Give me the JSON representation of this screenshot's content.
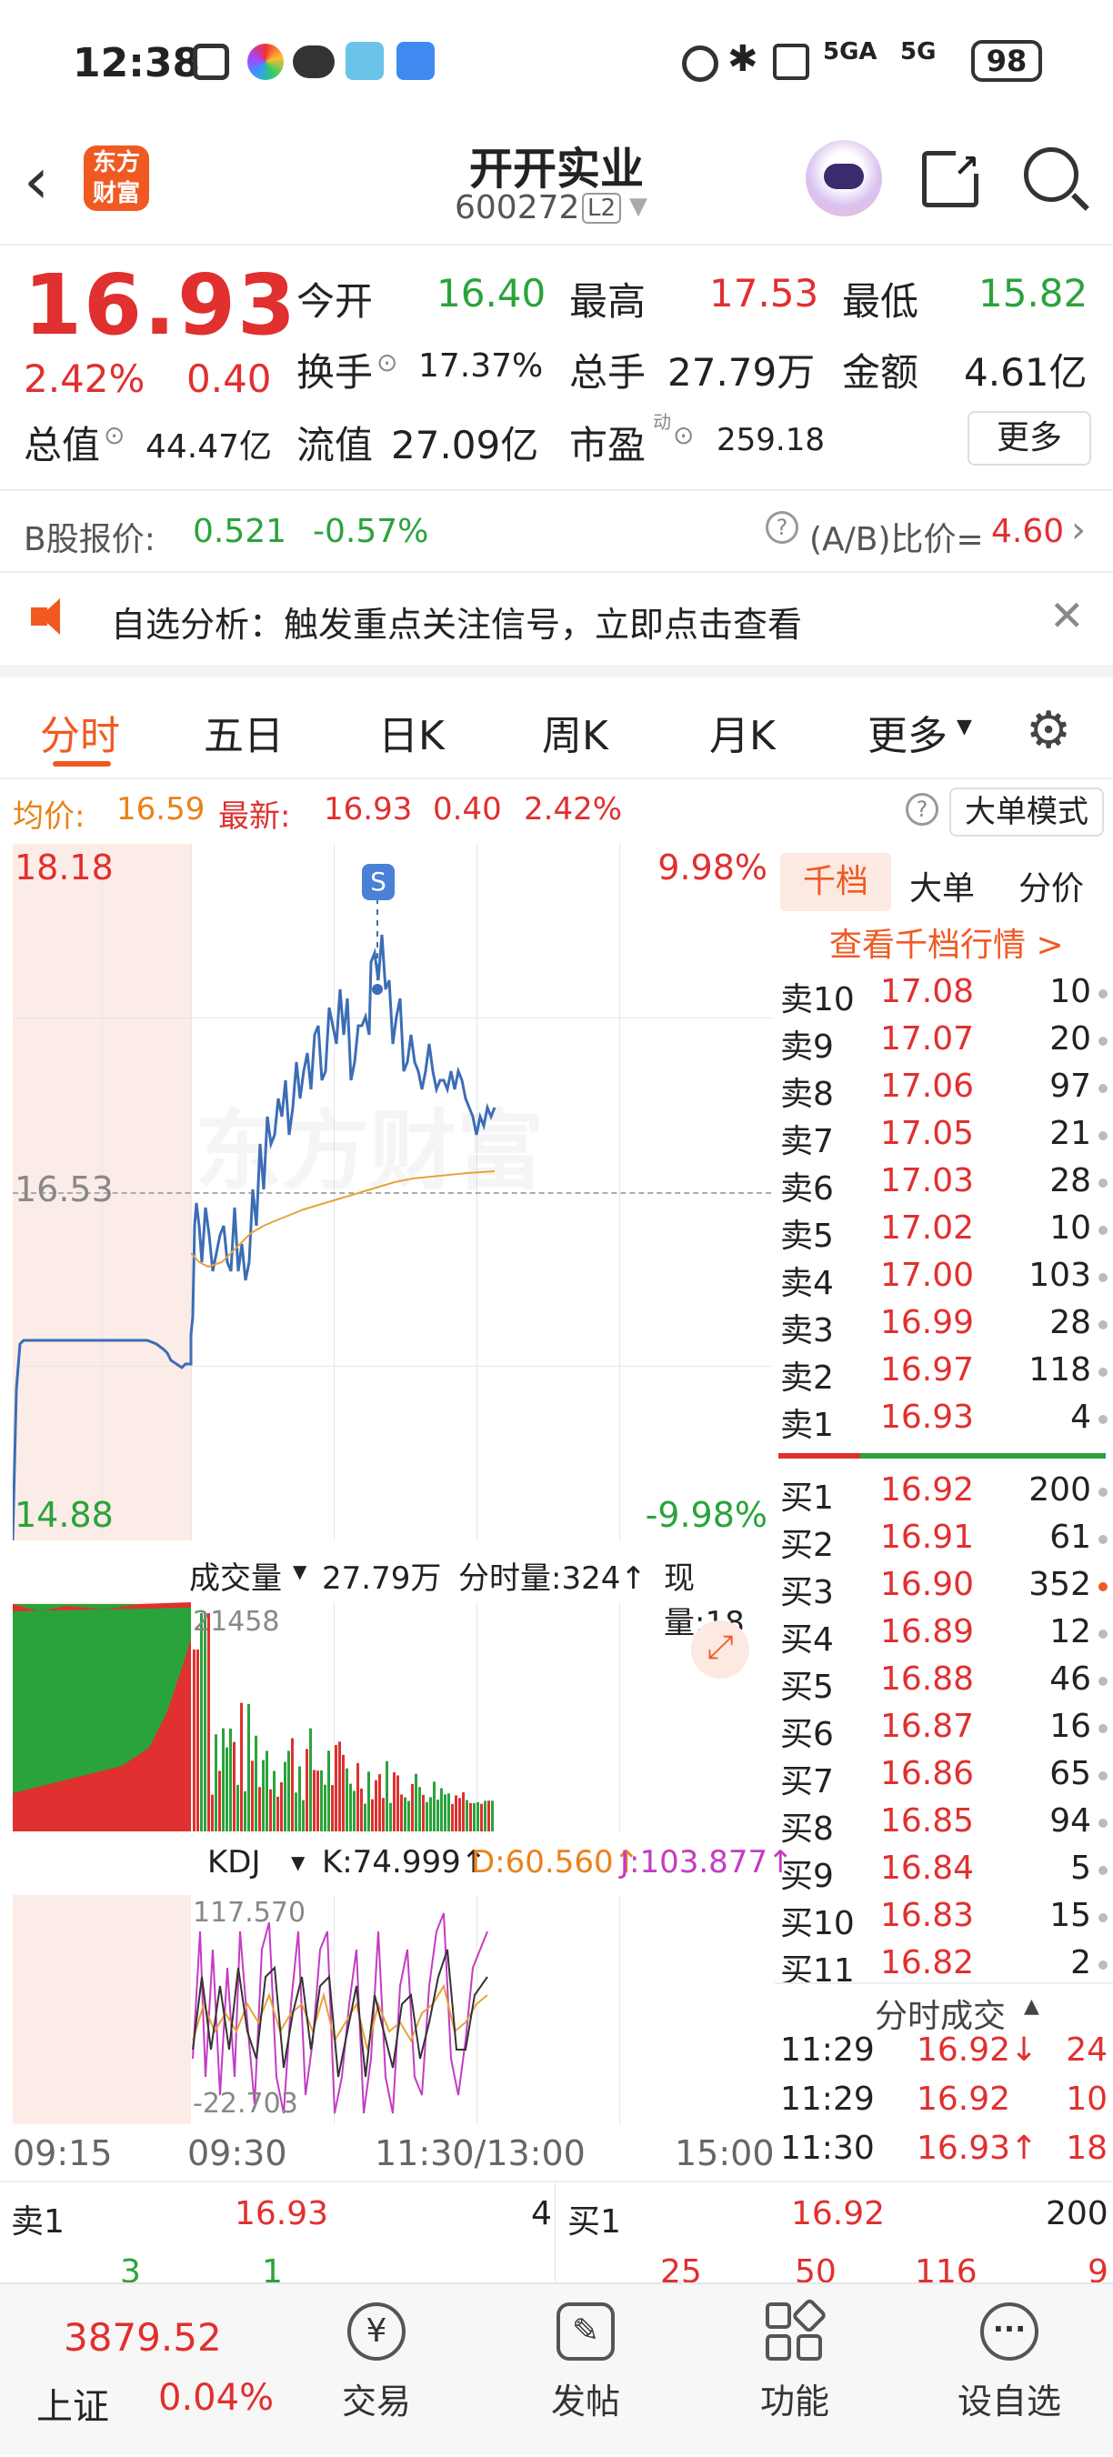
{
  "status": {
    "time": "12:38",
    "battery": "98",
    "signal1": "5GA",
    "signal2": "5G"
  },
  "header": {
    "logo_line1": "东方",
    "logo_line2": "财富",
    "title": "开开实业",
    "code": "600272",
    "level": "L2"
  },
  "quote": {
    "price": "16.93",
    "change_pct": "2.42%",
    "change": "0.40",
    "open_label": "今开",
    "open": "16.40",
    "high_label": "最高",
    "high": "17.53",
    "low_label": "最低",
    "low": "15.82",
    "turnover_label": "换手",
    "turnover": "17.37%",
    "volume_label": "总手",
    "volume": "27.79万",
    "amount_label": "金额",
    "amount": "4.61亿",
    "mktcap_label": "总值",
    "mktcap": "44.47亿",
    "float_label": "流值",
    "float": "27.09亿",
    "pe_label": "市盈",
    "pe_sup": "动",
    "pe": "259.18",
    "more_button": "更多"
  },
  "bshare": {
    "label": "B股报价:",
    "price": "0.521",
    "pct": "-0.57%",
    "ratio_label": "(A/B)比价=",
    "ratio": "4.60"
  },
  "notice": {
    "text": "自选分析：触发重点关注信号，立即点击查看"
  },
  "tabs": [
    "分时",
    "五日",
    "日K",
    "周K",
    "月K",
    "更多"
  ],
  "avgline": {
    "avg_label": "均价:",
    "avg": "16.59",
    "last_label": "最新:",
    "last": "16.93",
    "chg": "0.40",
    "pct": "2.42%",
    "mode_button": "大单模式"
  },
  "chart": {
    "ymax": "18.18",
    "ymid": "16.53",
    "ymin": "14.88",
    "pct_max": "9.98%",
    "pct_min": "-9.98%",
    "marker": "S",
    "watermark": "东方财富",
    "vol_label": "成交量",
    "vol_total": "27.79万",
    "vol_tick_label": "分时量:324↑",
    "vol_now": "现量:18",
    "vol_max": "21458",
    "kdj_label": "KDJ",
    "kdj_k": "K:74.999↑",
    "kdj_d": "D:60.560↑",
    "kdj_j": "J:103.877↑",
    "kdj_max": "117.570",
    "kdj_min": "-22.703",
    "times": [
      "09:15",
      "09:30",
      "11:30/13:00",
      "15:00"
    ]
  },
  "book": {
    "tabs": [
      "千档",
      "大单",
      "分价"
    ],
    "link": "查看千档行情 >",
    "asks": [
      {
        "l": "卖10",
        "p": "17.08",
        "v": "10"
      },
      {
        "l": "卖9",
        "p": "17.07",
        "v": "20"
      },
      {
        "l": "卖8",
        "p": "17.06",
        "v": "97"
      },
      {
        "l": "卖7",
        "p": "17.05",
        "v": "21"
      },
      {
        "l": "卖6",
        "p": "17.03",
        "v": "28"
      },
      {
        "l": "卖5",
        "p": "17.02",
        "v": "10"
      },
      {
        "l": "卖4",
        "p": "17.00",
        "v": "103"
      },
      {
        "l": "卖3",
        "p": "16.99",
        "v": "28"
      },
      {
        "l": "卖2",
        "p": "16.97",
        "v": "118"
      },
      {
        "l": "卖1",
        "p": "16.93",
        "v": "4"
      }
    ],
    "bids": [
      {
        "l": "买1",
        "p": "16.92",
        "v": "200"
      },
      {
        "l": "买2",
        "p": "16.91",
        "v": "61"
      },
      {
        "l": "买3",
        "p": "16.90",
        "v": "352"
      },
      {
        "l": "买4",
        "p": "16.89",
        "v": "12"
      },
      {
        "l": "买5",
        "p": "16.88",
        "v": "46"
      },
      {
        "l": "买6",
        "p": "16.87",
        "v": "16"
      },
      {
        "l": "买7",
        "p": "16.86",
        "v": "65"
      },
      {
        "l": "买8",
        "p": "16.85",
        "v": "94"
      },
      {
        "l": "买9",
        "p": "16.84",
        "v": "5"
      },
      {
        "l": "买10",
        "p": "16.83",
        "v": "15"
      },
      {
        "l": "买11",
        "p": "16.82",
        "v": "2"
      }
    ],
    "trades_title": "分时成交",
    "trades": [
      {
        "t": "11:29",
        "p": "16.92↓",
        "v": "24"
      },
      {
        "t": "11:29",
        "p": "16.92",
        "v": "10"
      },
      {
        "t": "11:30",
        "p": "16.93↑",
        "v": "18"
      }
    ]
  },
  "bottom_quote": {
    "sell_label": "卖1",
    "sell_price": "16.93",
    "sell_vol": "4",
    "buy_label": "买1",
    "buy_price": "16.92",
    "buy_vol": "200",
    "n1": "3",
    "n2": "1",
    "n3": "25",
    "n4": "50",
    "n5": "116",
    "n6": "9"
  },
  "bottombar": {
    "index_value": "3879.52",
    "index_name": "上证",
    "index_pct": "0.04%",
    "items": [
      "交易",
      "发帖",
      "功能",
      "设自选"
    ]
  },
  "colors": {
    "up": "#e0302f",
    "down": "#2aa33a",
    "accent": "#f05a22"
  }
}
